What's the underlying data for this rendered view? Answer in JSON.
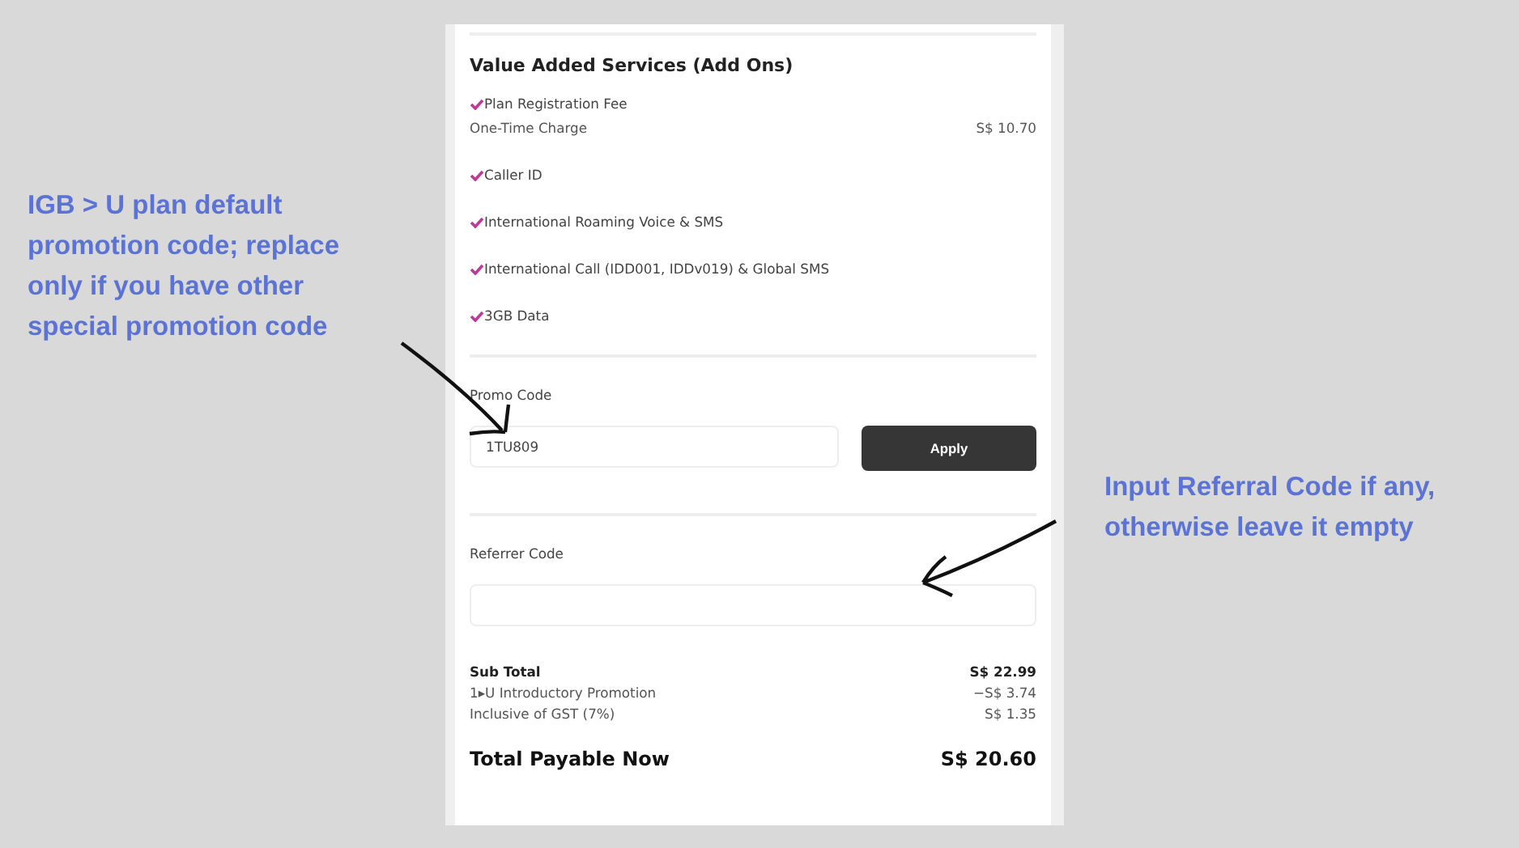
{
  "annotations": {
    "left": "IGB > U plan default promotion code; replace only if you have other special promotion code",
    "right": "Input Referral Code if any, otherwise leave it empty"
  },
  "addons": {
    "title": "Value Added Services (Add Ons)",
    "items": [
      {
        "name": "Plan Registration Fee",
        "checked": true,
        "detail": "One-Time Charge",
        "price": "S$ 10.70"
      },
      {
        "name": "Caller ID",
        "checked": true
      },
      {
        "name": "International Roaming Voice & SMS",
        "checked": true
      },
      {
        "name": "International Call (IDD001, IDDv019) & Global SMS",
        "checked": true
      },
      {
        "name": "3GB Data",
        "checked": true
      }
    ]
  },
  "promo": {
    "label": "Promo Code",
    "value": "1TU809",
    "button": "Apply"
  },
  "referrer": {
    "label": "Referrer Code"
  },
  "summary": [
    {
      "label": "Sub Total",
      "amount": "S$ 22.99",
      "bold": true
    },
    {
      "label": "1▸U Introductory Promotion",
      "amount": "−S$ 3.74",
      "bold": false
    },
    {
      "label": "Inclusive of GST (7%)",
      "amount": "S$ 1.35",
      "bold": false
    }
  ],
  "total": {
    "label": "Total Payable Now",
    "amount": "S$ 20.60"
  }
}
